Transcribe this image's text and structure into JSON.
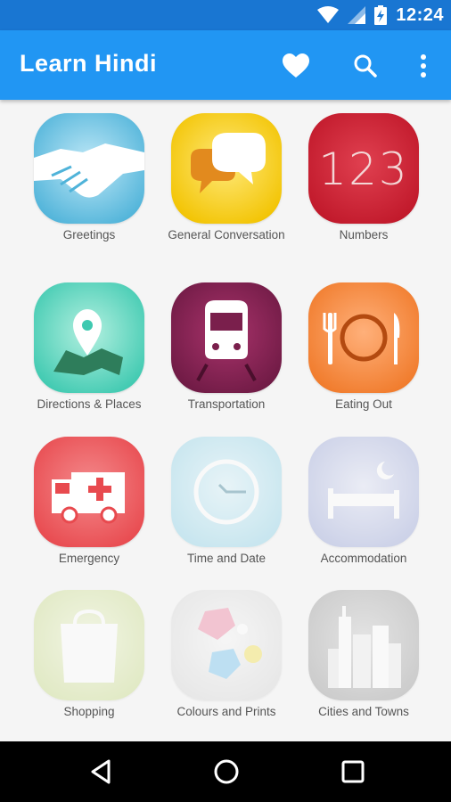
{
  "status_bar": {
    "time": "12:24",
    "icons": [
      "wifi-icon",
      "signal-icon",
      "battery-charging-icon"
    ],
    "color": "#1976d2"
  },
  "app_bar": {
    "title": "Learn Hindi",
    "actions": [
      "favorite-heart-icon",
      "search-icon",
      "overflow-menu-icon"
    ],
    "color": "#2196f3"
  },
  "categories": [
    {
      "label": "Greetings",
      "icon": "handshake-icon",
      "color": "#4fb3d9"
    },
    {
      "label": "General Conversation",
      "icon": "speech-bubbles-icon",
      "color": "#f2c300"
    },
    {
      "label": "Numbers",
      "icon": "numbers-123-icon",
      "color": "#c0182a"
    },
    {
      "label": "Directions & Places",
      "icon": "map-pin-icon",
      "color": "#3ec9b0"
    },
    {
      "label": "Transportation",
      "icon": "train-icon",
      "color": "#7a1f4c"
    },
    {
      "label": "Eating Out",
      "icon": "plate-cutlery-icon",
      "color": "#f07a2a"
    },
    {
      "label": "Emergency",
      "icon": "ambulance-icon",
      "color": "#e84a4f"
    },
    {
      "label": "Time and Date",
      "icon": "clock-icon",
      "color": "#8fd3e8"
    },
    {
      "label": "Accommodation",
      "icon": "bed-moon-icon",
      "color": "#9aa6d8"
    },
    {
      "label": "Shopping",
      "icon": "shopping-bag-icon",
      "color": "#c9dc8a"
    },
    {
      "label": "Colours and Prints",
      "icon": "colour-shapes-icon",
      "color": "#d7d7d7"
    },
    {
      "label": "Cities and Towns",
      "icon": "city-skyline-icon",
      "color": "#9a9a9a"
    }
  ],
  "numbers_icon_text": "123",
  "nav_bar": {
    "buttons": [
      "back-icon",
      "home-icon",
      "recents-icon"
    ]
  }
}
